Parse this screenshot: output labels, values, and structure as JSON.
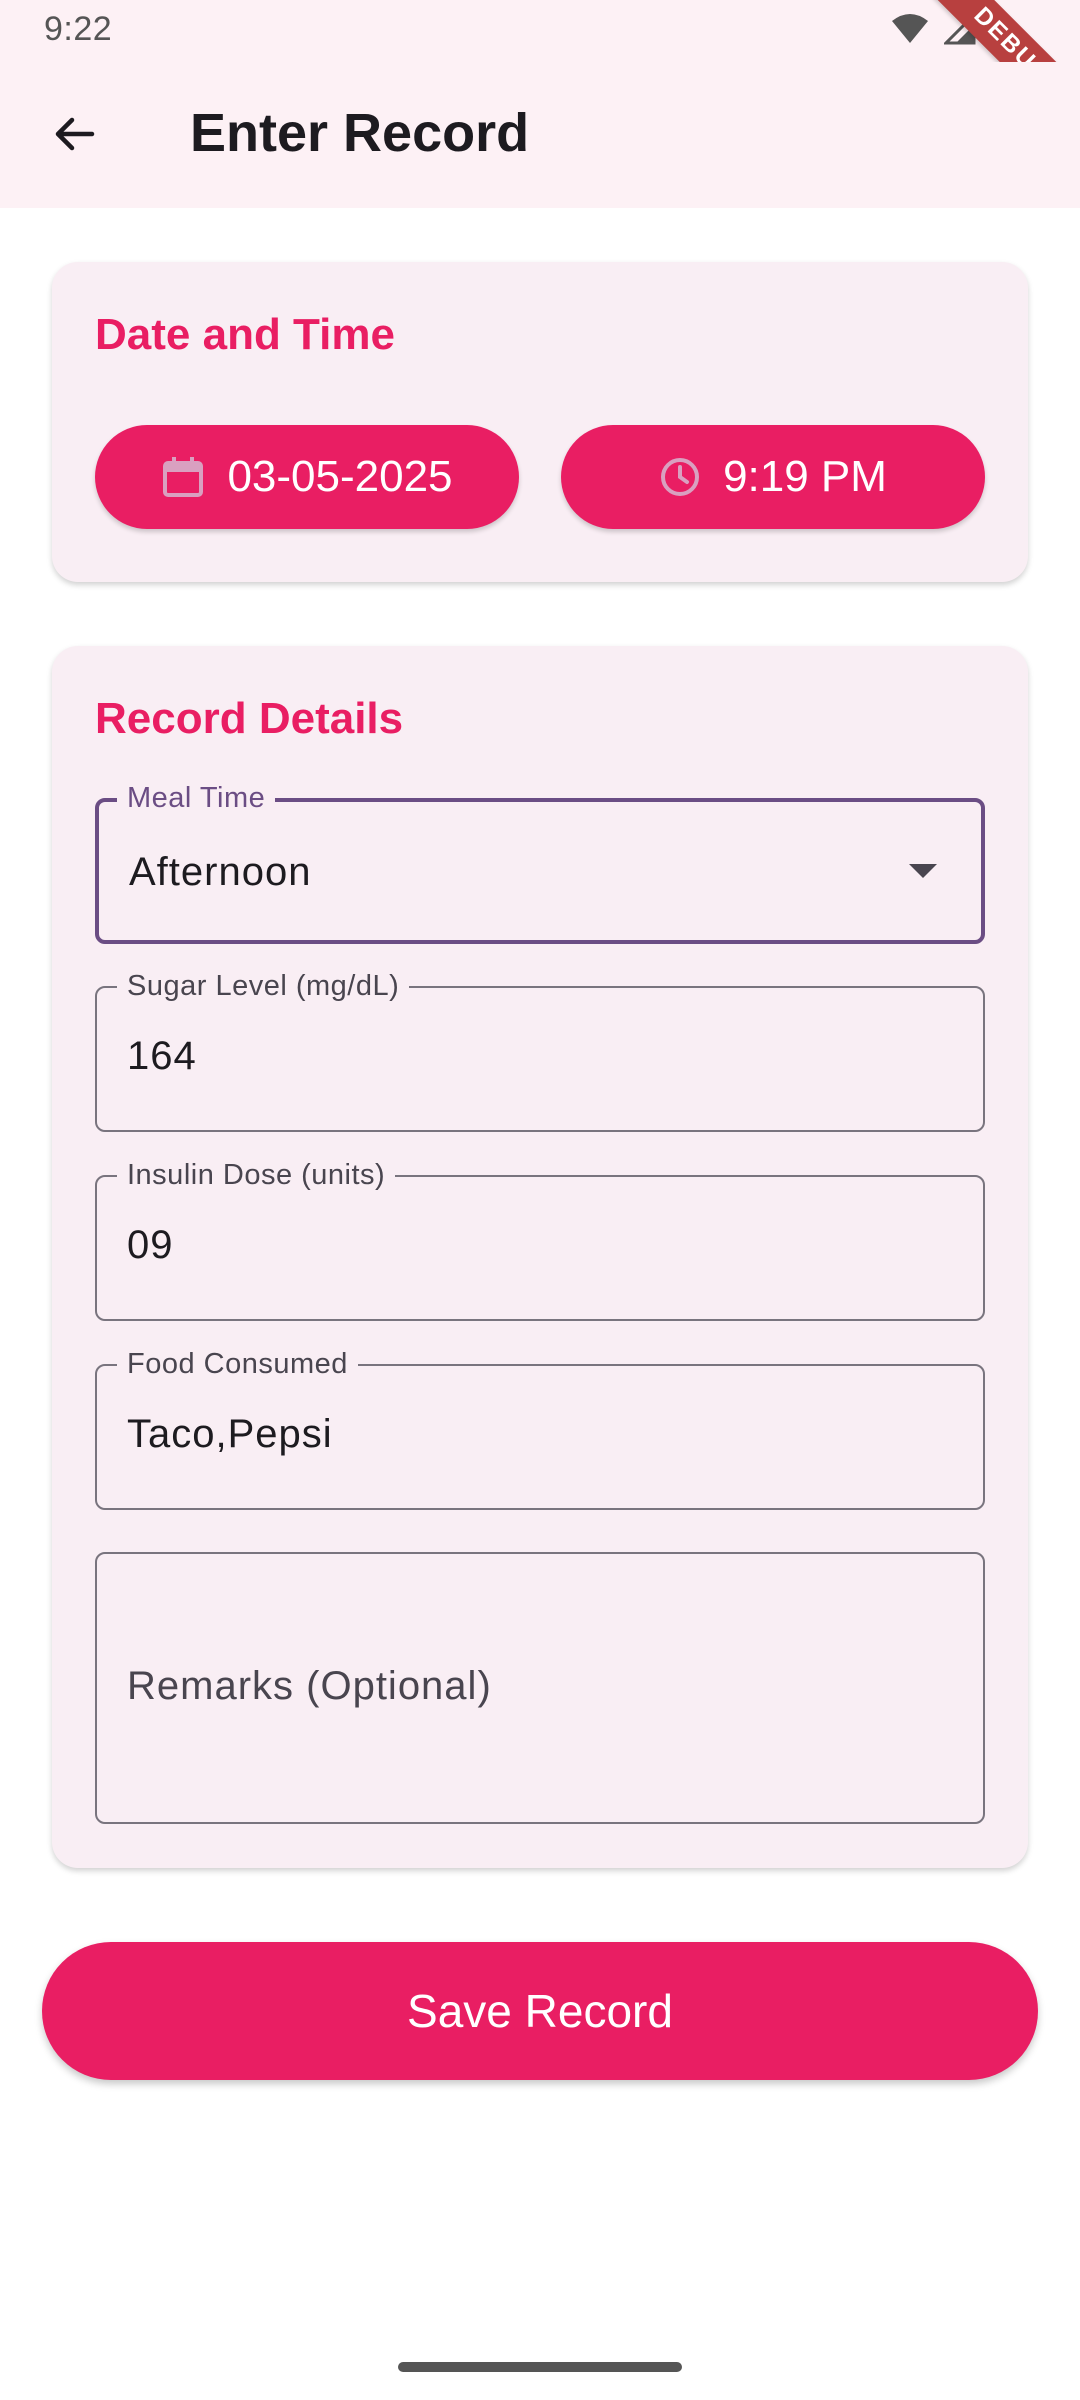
{
  "status_bar": {
    "time": "9:22",
    "debug_banner": "DEBUG"
  },
  "app_bar": {
    "title": "Enter Record"
  },
  "date_time_card": {
    "title": "Date and Time",
    "date": "03-05-2025",
    "time": "9:19 PM"
  },
  "details_card": {
    "title": "Record Details",
    "meal_time": {
      "label": "Meal Time",
      "value": "Afternoon"
    },
    "sugar_level": {
      "label": "Sugar Level (mg/dL)",
      "value": "164"
    },
    "insulin_dose": {
      "label": "Insulin Dose (units)",
      "value": "09"
    },
    "food_consumed": {
      "label": "Food Consumed",
      "value": "Taco,Pepsi"
    },
    "remarks": {
      "placeholder": "Remarks (Optional)"
    }
  },
  "actions": {
    "save_label": "Save Record"
  },
  "colors": {
    "accent": "#e91e63",
    "app_bar_bg": "#fdf1f5",
    "card_bg": "#f9eef4",
    "focus_border": "#6b4d84"
  }
}
